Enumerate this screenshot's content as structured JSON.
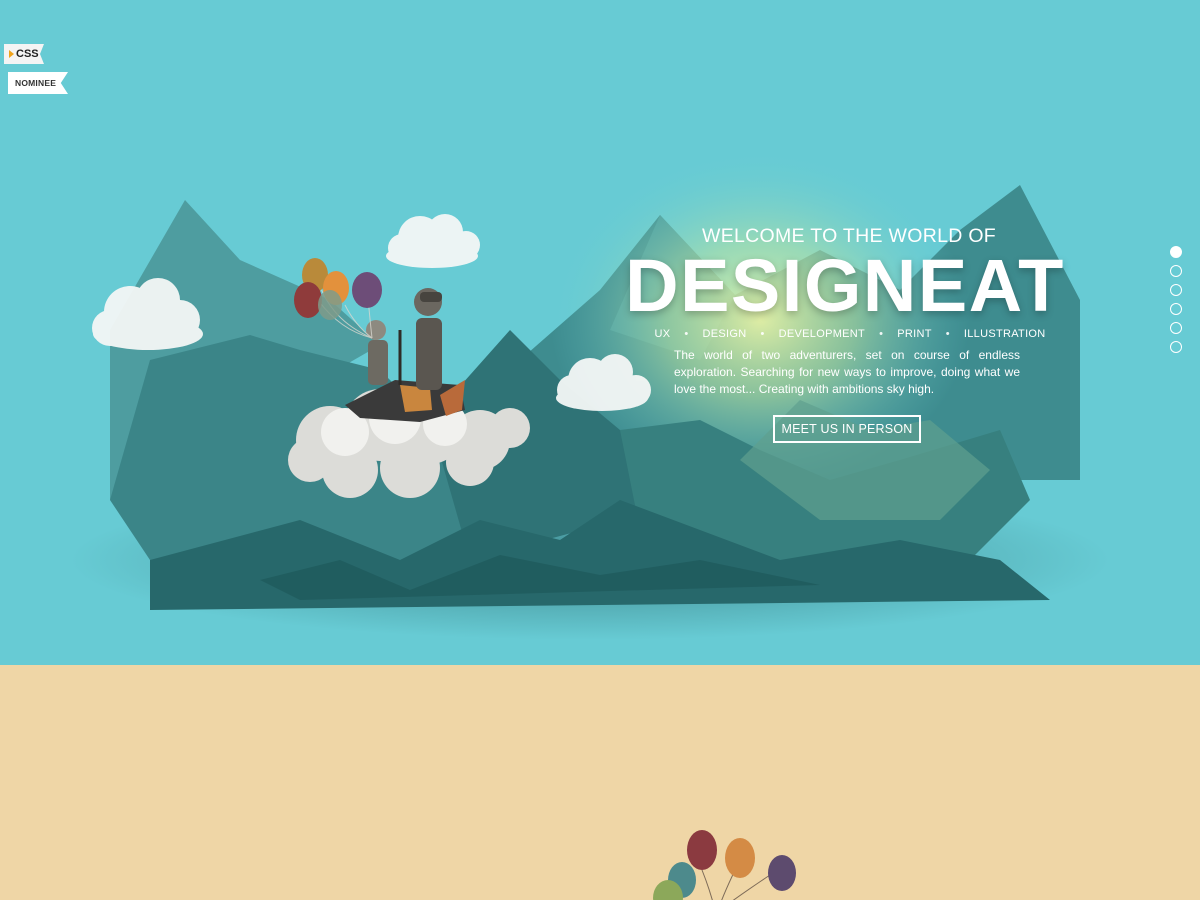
{
  "badge": {
    "css_label": "CSS",
    "nominee_label": "NOMINEE"
  },
  "hero": {
    "welcome": "WELCOME TO THE WORLD OF",
    "brand": "DESIGNEAT",
    "services": [
      "UX",
      "DESIGN",
      "DEVELOPMENT",
      "PRINT",
      "ILLUSTRATION"
    ],
    "description": "The world of two adventurers, set on course of endless exploration. Searching for new ways to improve, doing what we love the most... Creating with ambitions sky high.",
    "cta_label": "MEET US IN PERSON"
  },
  "nav_dots": {
    "count": 6,
    "active_index": 0
  },
  "colors": {
    "sky": "#67cbd4",
    "sand": "#efd6a6",
    "mountain_dark": "#2f6f72",
    "mountain_mid": "#3f8a8c",
    "text": "#ffffff"
  },
  "icons": {
    "badge_icon": "css-award-icon",
    "illustration": "balloon-adventurers-illustration"
  }
}
